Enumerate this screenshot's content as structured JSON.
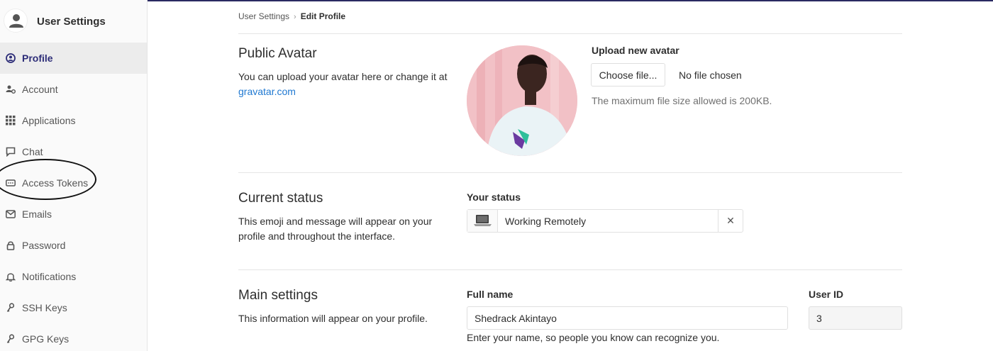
{
  "sidebar": {
    "title": "User Settings",
    "items": [
      {
        "label": "Profile",
        "icon": "profile-icon",
        "active": true
      },
      {
        "label": "Account",
        "icon": "account-gear-icon"
      },
      {
        "label": "Applications",
        "icon": "applications-grid-icon"
      },
      {
        "label": "Chat",
        "icon": "chat-icon"
      },
      {
        "label": "Access Tokens",
        "icon": "token-icon"
      },
      {
        "label": "Emails",
        "icon": "email-icon"
      },
      {
        "label": "Password",
        "icon": "lock-icon"
      },
      {
        "label": "Notifications",
        "icon": "bell-icon"
      },
      {
        "label": "SSH Keys",
        "icon": "key-icon"
      },
      {
        "label": "GPG Keys",
        "icon": "key-icon"
      }
    ]
  },
  "breadcrumb": {
    "parent": "User Settings",
    "separator": "›",
    "current": "Edit Profile"
  },
  "avatar_section": {
    "title": "Public Avatar",
    "desc": "You can upload your avatar here or change it at ",
    "link": "gravatar.com",
    "upload_label": "Upload new avatar",
    "choose_button": "Choose file...",
    "no_file": "No file chosen",
    "help": "The maximum file size allowed is 200KB."
  },
  "status_section": {
    "title": "Current status",
    "desc": "This emoji and message will appear on your profile and throughout the interface.",
    "label": "Your status",
    "emoji": "laptop-emoji-icon",
    "value": "Working Remotely",
    "clear": "✕"
  },
  "main_section": {
    "title": "Main settings",
    "desc": "This information will appear on your profile.",
    "full_name_label": "Full name",
    "full_name_value": "Shedrack Akintayo",
    "full_name_help": "Enter your name, so people you know can recognize you.",
    "user_id_label": "User ID",
    "user_id_value": "3"
  },
  "colors": {
    "accent": "#2d2d78",
    "link": "#1f78d1",
    "sidebar_bg": "#fafafa",
    "active_bg": "#ececec"
  }
}
